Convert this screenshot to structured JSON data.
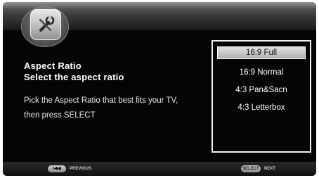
{
  "menu": {
    "icon": "wrench-tools-icon",
    "title": "Aspect Ratio",
    "subtitle": "Select the aspect ratio",
    "description_line1": "Pick the Aspect Ratio that best fits your TV,",
    "description_line2": "then press SELECT"
  },
  "options": {
    "selected_index": 0,
    "items": [
      "16:9 Full",
      "16:9 Normal",
      "4:3 Pan&Sacn",
      "4:3 Letterbox"
    ]
  },
  "footer": {
    "previous_button": "I◀◀",
    "previous_label": "PREVIOUS",
    "select_button": "SELECT",
    "next_label": "NEXT"
  }
}
